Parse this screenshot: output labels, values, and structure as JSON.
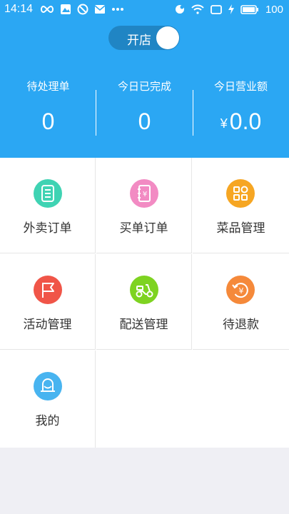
{
  "status_bar": {
    "time": "14:14",
    "battery": "100",
    "left_icons": [
      "infinity-icon",
      "image-icon",
      "blocked-icon",
      "mail-icon",
      "more-dots-icon"
    ],
    "right_icons": [
      "notification-icon",
      "wifi-icon",
      "screen-icon",
      "charging-icon",
      "battery-icon"
    ]
  },
  "toggle": {
    "label": "开店",
    "on": true
  },
  "stats": [
    {
      "title": "待处理单",
      "value": "0",
      "currency": ""
    },
    {
      "title": "今日已完成",
      "value": "0",
      "currency": ""
    },
    {
      "title": "今日营业额",
      "value": "0.0",
      "currency": "¥"
    }
  ],
  "menu": [
    {
      "label": "外卖订单",
      "icon": "order-list-icon",
      "color": "#3fd3b3"
    },
    {
      "label": "买单订单",
      "icon": "bill-notebook-icon",
      "color": "#f28bc3"
    },
    {
      "label": "菜品管理",
      "icon": "dish-grid-icon",
      "color": "#f6a623"
    },
    {
      "label": "活动管理",
      "icon": "flag-icon",
      "color": "#f05548"
    },
    {
      "label": "配送管理",
      "icon": "scooter-icon",
      "color": "#7ed321"
    },
    {
      "label": "待退款",
      "icon": "refund-icon",
      "color": "#f5893a"
    },
    {
      "label": "我的",
      "icon": "user-icon",
      "color": "#48b4f0"
    }
  ],
  "colors": {
    "header_bg": "#2ba7f3",
    "toggle_bg": "#2085c4",
    "page_bg": "#efeff4"
  }
}
